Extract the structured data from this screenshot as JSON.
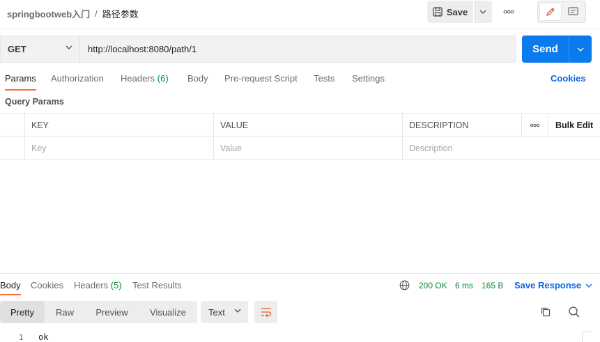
{
  "header": {
    "collection": "springbootweb入门",
    "separator": "/",
    "request_name": "路径参数",
    "save_label": "Save"
  },
  "request": {
    "method": "GET",
    "url": "http://localhost:8080/path/1",
    "send_label": "Send"
  },
  "request_tabs": [
    {
      "label": "Params",
      "count": ""
    },
    {
      "label": "Authorization",
      "count": ""
    },
    {
      "label": "Headers",
      "count": "(6)"
    },
    {
      "label": "Body",
      "count": ""
    },
    {
      "label": "Pre-request Script",
      "count": ""
    },
    {
      "label": "Tests",
      "count": ""
    },
    {
      "label": "Settings",
      "count": ""
    }
  ],
  "cookies_label": "Cookies",
  "query_params": {
    "title": "Query Params",
    "columns": [
      "KEY",
      "VALUE",
      "DESCRIPTION"
    ],
    "bulk_edit": "Bulk Edit",
    "placeholders": [
      "Key",
      "Value",
      "Description"
    ]
  },
  "response": {
    "tabs": [
      {
        "label": "Body",
        "count": ""
      },
      {
        "label": "Cookies",
        "count": ""
      },
      {
        "label": "Headers",
        "count": "(5)"
      },
      {
        "label": "Test Results",
        "count": ""
      }
    ],
    "status": "200 OK",
    "time": "6 ms",
    "size": "165 B",
    "save_label": "Save Response",
    "formats": [
      "Pretty",
      "Raw",
      "Preview",
      "Visualize"
    ],
    "language": "Text",
    "lines": [
      {
        "no": "1",
        "text": "ok"
      }
    ]
  },
  "colors": {
    "accent": "#ff6c37",
    "send": "#097bed",
    "link": "#0b66e4",
    "success": "#0a8a3a"
  }
}
